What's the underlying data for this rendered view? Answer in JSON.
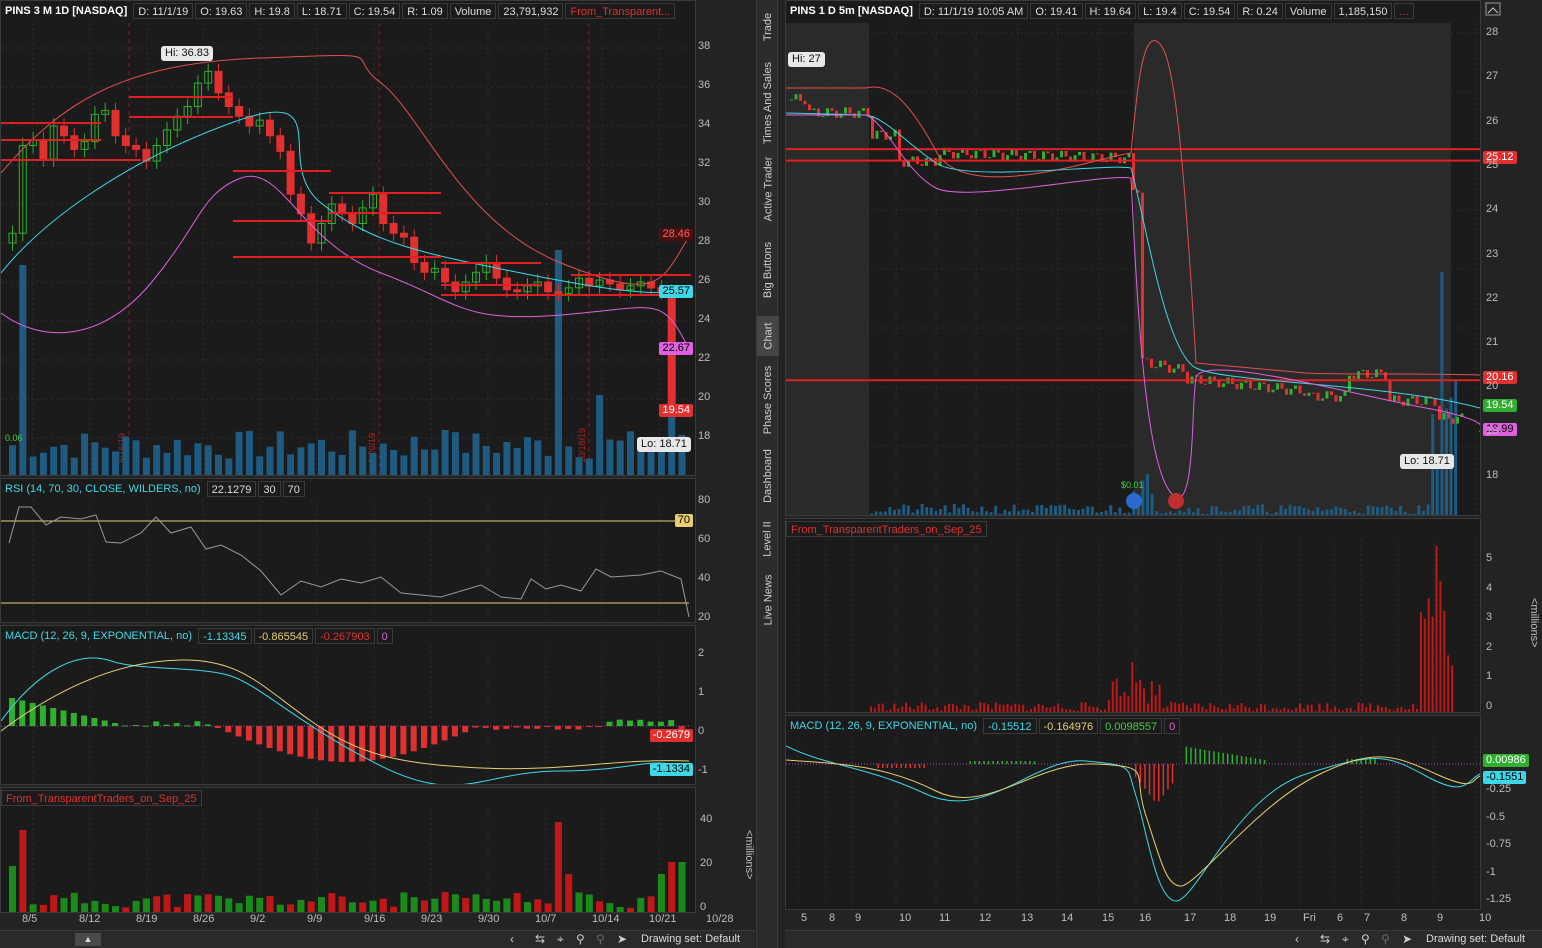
{
  "left": {
    "symbol": "PINS 3 M 1D [NASDAQ]",
    "date": "D: 11/1/19",
    "open": "O: 19.63",
    "high": "H: 19.8",
    "low": "L: 18.71",
    "close": "C: 19.54",
    "range": "R: 1.09",
    "volume_label": "Volume",
    "volume": "23,791,932",
    "study": "From_Transparent...",
    "hi_label": "Hi: 36.83",
    "lo_label": "Lo: 18.71",
    "price_ticks": [
      "38",
      "36",
      "34",
      "32",
      "30",
      "28",
      "26",
      "24",
      "22",
      "20",
      "18"
    ],
    "tags": {
      "upper": "28.46",
      "mid": "25.57",
      "lower": "22.67",
      "last": "19.54"
    },
    "vol_marker": "0.06",
    "date_marks": [
      "8/16/19",
      "9/20/19",
      "10/18/19"
    ],
    "rsi_header": "RSI (14, 70, 30, CLOSE, WILDERS, no)",
    "rsi_value": "22.1279",
    "rsi_low": "30",
    "rsi_high": "70",
    "rsi_ticks": [
      "80",
      "60",
      "40",
      "20"
    ],
    "rsi_tag": "70",
    "macd_header": "MACD (12, 26, 9, EXPONENTIAL, no)",
    "macd_v1": "-1.13345",
    "macd_v2": "-0.865545",
    "macd_v3": "-0.267903",
    "macd_v4": "0",
    "macd_ticks": [
      "2",
      "1",
      "0",
      "-1"
    ],
    "macd_tags": {
      "hist": "-0.2679",
      "value": "-1.1334"
    },
    "vol_header": "From_TransparentTraders_on_Sep_25",
    "vol_ticks": [
      "40",
      "20",
      "0"
    ],
    "millions": "<millions>",
    "x_labels": [
      "8/5",
      "8/12",
      "8/19",
      "8/26",
      "9/2",
      "9/9",
      "9/16",
      "9/23",
      "9/30",
      "10/7",
      "10/14",
      "10/21",
      "10/28"
    ],
    "drawing_set": "Drawing set: Default"
  },
  "sidebar": {
    "tabs": [
      "Trade",
      "Times And Sales",
      "Active Trader",
      "Big Buttons",
      "Chart",
      "Phase Scores",
      "Dashboard",
      "Level II",
      "Live News"
    ]
  },
  "right": {
    "symbol": "PINS 1 D 5m [NASDAQ]",
    "date": "D: 11/1/19 10:05 AM",
    "open": "O: 19.41",
    "high": "H: 19.64",
    "low": "L: 19.4",
    "close": "C: 19.54",
    "range": "R: 0.24",
    "volume_label": "Volume",
    "volume": "1,185,150",
    "study": "...",
    "hi_label": "Hi: 27",
    "lo_label": "Lo: 18.71",
    "price_ticks": [
      "28",
      "27",
      "26",
      "25",
      "24",
      "23",
      "22",
      "21",
      "20",
      "19",
      "18"
    ],
    "tags": {
      "resistance": "25.12",
      "support": "20.16",
      "last": "19.54",
      "lower": "18.99"
    },
    "vol_marker": "$0.01",
    "vol_header": "From_TransparentTraders_on_Sep_25",
    "vol_ticks": [
      "5",
      "4",
      "3",
      "2",
      "1",
      "0"
    ],
    "millions": "<millions>",
    "macd_header": "MACD (12, 26, 9, EXPONENTIAL, no)",
    "macd_v1": "-0.15512",
    "macd_v2": "-0.164976",
    "macd_v3": "0.0098557",
    "macd_v4": "0",
    "macd_ticks": [
      "-0.25",
      "-0.5",
      "-0.75",
      "-1",
      "-1.25"
    ],
    "macd_tags": {
      "hist": "0.00986",
      "value": "-0.1551"
    },
    "x_labels": [
      "5",
      "8",
      "9",
      "10",
      "11",
      "12",
      "13",
      "14",
      "15",
      "16",
      "17",
      "18",
      "19",
      "Fri",
      "6",
      "7",
      "8",
      "9",
      "10"
    ],
    "drawing_set": "Drawing set: Default"
  },
  "colors": {
    "up": "#2fae2f",
    "down": "#e03030",
    "volume": "#1f5a80",
    "cyan": "#3cd8e8",
    "magenta": "#e060e0",
    "bollinger": "#e05050"
  }
}
